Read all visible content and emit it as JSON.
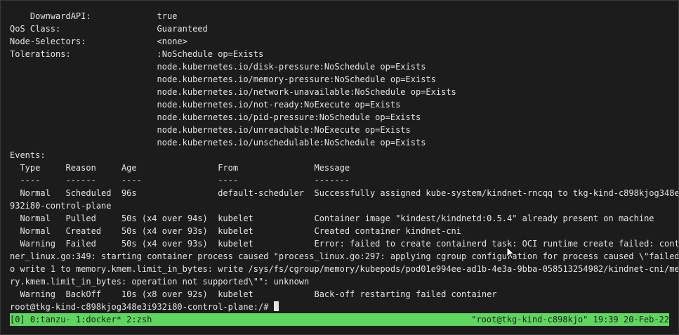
{
  "terminal": {
    "lines": [
      "    DownwardAPI:             true",
      "QoS Class:                   Guaranteed",
      "Node-Selectors:              <none>",
      "Tolerations:                 :NoSchedule op=Exists",
      "                             node.kubernetes.io/disk-pressure:NoSchedule op=Exists",
      "                             node.kubernetes.io/memory-pressure:NoSchedule op=Exists",
      "                             node.kubernetes.io/network-unavailable:NoSchedule op=Exists",
      "                             node.kubernetes.io/not-ready:NoExecute op=Exists",
      "                             node.kubernetes.io/pid-pressure:NoSchedule op=Exists",
      "                             node.kubernetes.io/unreachable:NoExecute op=Exists",
      "                             node.kubernetes.io/unschedulable:NoSchedule op=Exists",
      "Events:",
      "  Type     Reason     Age                From               Message",
      "  ----     ------     ----               ----               -------",
      "  Normal   Scheduled  96s                default-scheduler  Successfully assigned kube-system/kindnet-rncqq to tkg-kind-c898kjog348e3i",
      "932i80-control-plane",
      "  Normal   Pulled     50s (x4 over 94s)  kubelet            Container image \"kindest/kindnetd:0.5.4\" already present on machine",
      "  Normal   Created    50s (x4 over 93s)  kubelet            Created container kindnet-cni",
      "  Warning  Failed     50s (x4 over 93s)  kubelet            Error: failed to create containerd task: OCI runtime create failed: contai",
      "ner_linux.go:349: starting container process caused \"process_linux.go:297: applying cgroup configuration for process caused \\\"failed t",
      "o write 1 to memory.kmem.limit_in_bytes: write /sys/fs/cgroup/memory/kubepods/pod01e994ee-ad1b-4e3a-9bba-058513254982/kindnet-cni/memo",
      "ry.kmem.limit_in_bytes: operation not supported\\\"\": unknown",
      "  Warning  BackOff    10s (x8 over 92s)  kubelet            Back-off restarting failed container"
    ],
    "prompt": "root@tkg-kind-c898kjog348e3i932i80-control-plane:/# "
  },
  "status_bar": {
    "left": "[0] 0:tanzu- 1:docker* 2:zsh",
    "right": "\"root@tkg-kind-c898kjo\" 19:39 20-Feb-22"
  },
  "colors": {
    "background": "#1c1c1c",
    "foreground": "#e4e4e4",
    "status_bar": "#5fd75f"
  }
}
